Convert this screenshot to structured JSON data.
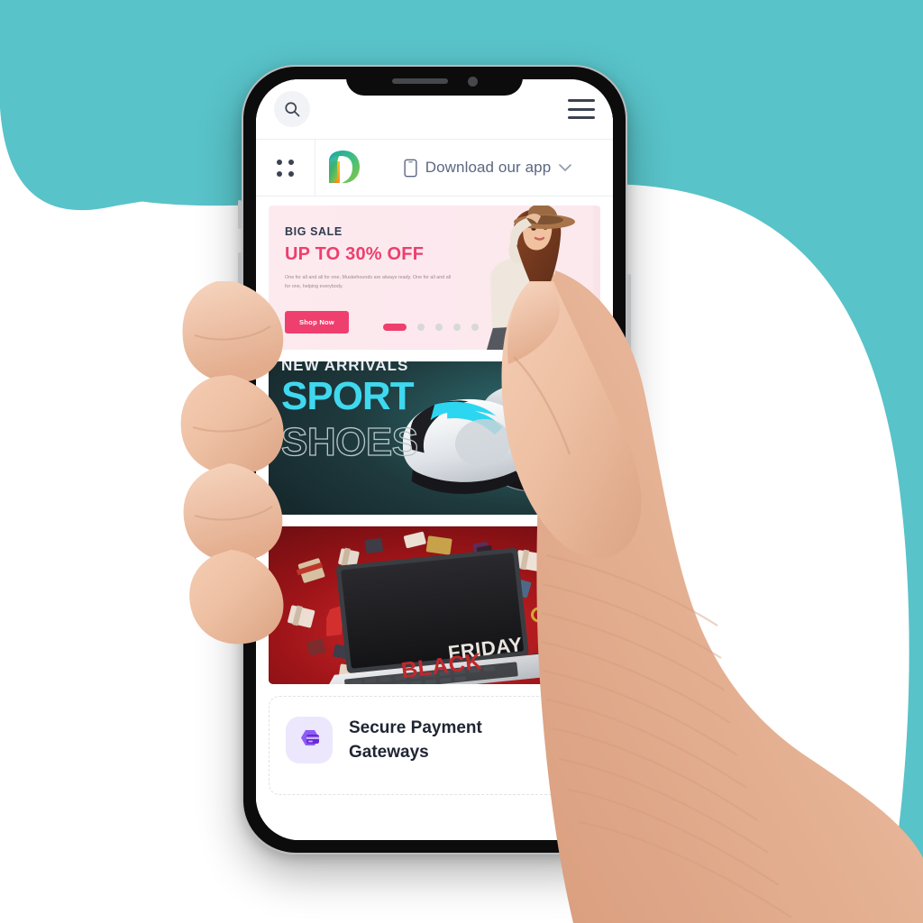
{
  "scene": {
    "background_color": "#58c3c9",
    "description": "mobile phone held in a hand showing an ecommerce app"
  },
  "phone": {
    "frame_color": "#0c0c0d",
    "bezel_color": "#b9bbbd",
    "notch": {
      "speaker": "speaker-grille",
      "camera": "front-camera"
    }
  },
  "app": {
    "topbar": {
      "search_icon": "search-icon",
      "menu_icon": "hamburger-menu-icon"
    },
    "subbar": {
      "grid_icon": "grid-dots-icon",
      "logo": "brand-logo-d",
      "download_label": "Download our app",
      "phone_icon": "mobile-phone-icon",
      "chevron_icon": "chevron-down-icon"
    },
    "hero": {
      "kicker": "BIG SALE",
      "headline": "UP TO 30% OFF",
      "subtext": "One for all and all for one, Muskehounds are always ready. One for all and all for one, helping everybody.",
      "cta_label": "Shop Now",
      "accent_color": "#ef3f6e",
      "background_color": "#fdeaef",
      "dots_total": 5,
      "dots_active": 1,
      "prev_icon": "chevron-left-icon",
      "next_icon": "chevron-right-icon"
    },
    "sport_banner": {
      "kicker": "NEW ARRIVALS",
      "title": "SPORT",
      "subtitle": "SHOES",
      "title_color": "#3fd8ef",
      "background_color": "#1f3a3d"
    },
    "friday_banner": {
      "text_primary": "BLACK",
      "text_secondary": "FRIDAY",
      "background_color": "#9d1418"
    },
    "payment_card": {
      "icon": "secure-payment-shield-icon",
      "icon_background": "#ece7fd",
      "icon_color": "#7a45e8",
      "title": "Secure Payment Gateways"
    }
  }
}
